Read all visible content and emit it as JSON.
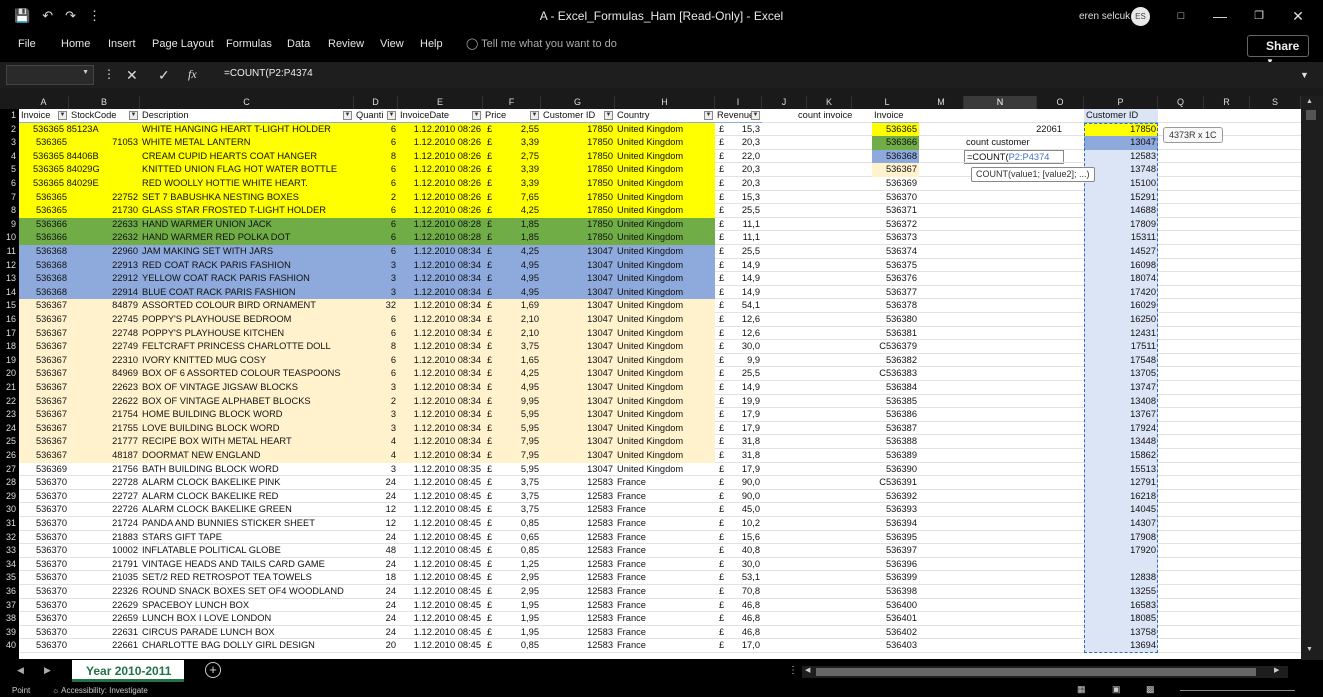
{
  "title": "A - Excel_Formulas_Ham [Read-Only] - Excel",
  "user": "eren selcuk",
  "user_initials": "ES",
  "menu": [
    "File",
    "Home",
    "Insert",
    "Page Layout",
    "Formulas",
    "Data",
    "Review",
    "View",
    "Help"
  ],
  "tell_me": "Tell me what you want to do",
  "share": "Share",
  "formula": "=COUNT(P2:P4374",
  "fx": "fx",
  "columns": [
    "A",
    "B",
    "C",
    "D",
    "E",
    "F",
    "G",
    "H",
    "I",
    "J",
    "K",
    "L",
    "M",
    "N",
    "O",
    "P",
    "Q",
    "R",
    "S"
  ],
  "headers": [
    "Invoice",
    "StockCode",
    "Description",
    "Quanti",
    "InvoiceDate",
    "Price",
    "Customer ID",
    "Country",
    "Revenue"
  ],
  "rows": [
    [
      "536365",
      "85123A",
      "WHITE HANGING HEART T-LIGHT HOLDER",
      "6",
      "1.12.2010 08:26",
      "£",
      "2,55",
      "17850",
      "United Kingdom",
      "£",
      "15,3"
    ],
    [
      "536365",
      "71053",
      "WHITE METAL LANTERN",
      "6",
      "1.12.2010 08:26",
      "£",
      "3,39",
      "17850",
      "United Kingdom",
      "£",
      "20,3"
    ],
    [
      "536365",
      "84406B",
      "CREAM CUPID HEARTS COAT HANGER",
      "8",
      "1.12.2010 08:26",
      "£",
      "2,75",
      "17850",
      "United Kingdom",
      "£",
      "22,0"
    ],
    [
      "536365",
      "84029G",
      "KNITTED UNION FLAG HOT WATER BOTTLE",
      "6",
      "1.12.2010 08:26",
      "£",
      "3,39",
      "17850",
      "United Kingdom",
      "£",
      "20,3"
    ],
    [
      "536365",
      "84029E",
      "RED WOOLLY HOTTIE WHITE HEART.",
      "6",
      "1.12.2010 08:26",
      "£",
      "3,39",
      "17850",
      "United Kingdom",
      "£",
      "20,3"
    ],
    [
      "536365",
      "22752",
      "SET 7 BABUSHKA NESTING BOXES",
      "2",
      "1.12.2010 08:26",
      "£",
      "7,65",
      "17850",
      "United Kingdom",
      "£",
      "15,3"
    ],
    [
      "536365",
      "21730",
      "GLASS STAR FROSTED T-LIGHT HOLDER",
      "6",
      "1.12.2010 08:26",
      "£",
      "4,25",
      "17850",
      "United Kingdom",
      "£",
      "25,5"
    ],
    [
      "536366",
      "22633",
      "HAND WARMER UNION JACK",
      "6",
      "1.12.2010 08:28",
      "£",
      "1,85",
      "17850",
      "United Kingdom",
      "£",
      "11,1"
    ],
    [
      "536366",
      "22632",
      "HAND WARMER RED POLKA DOT",
      "6",
      "1.12.2010 08:28",
      "£",
      "1,85",
      "17850",
      "United Kingdom",
      "£",
      "11,1"
    ],
    [
      "536368",
      "22960",
      "JAM MAKING SET WITH JARS",
      "6",
      "1.12.2010 08:34",
      "£",
      "4,25",
      "13047",
      "United Kingdom",
      "£",
      "25,5"
    ],
    [
      "536368",
      "22913",
      "RED COAT RACK PARIS FASHION",
      "3",
      "1.12.2010 08:34",
      "£",
      "4,95",
      "13047",
      "United Kingdom",
      "£",
      "14,9"
    ],
    [
      "536368",
      "22912",
      "YELLOW COAT RACK PARIS FASHION",
      "3",
      "1.12.2010 08:34",
      "£",
      "4,95",
      "13047",
      "United Kingdom",
      "£",
      "14,9"
    ],
    [
      "536368",
      "22914",
      "BLUE COAT RACK PARIS FASHION",
      "3",
      "1.12.2010 08:34",
      "£",
      "4,95",
      "13047",
      "United Kingdom",
      "£",
      "14,9"
    ],
    [
      "536367",
      "84879",
      "ASSORTED COLOUR BIRD ORNAMENT",
      "32",
      "1.12.2010 08:34",
      "£",
      "1,69",
      "13047",
      "United Kingdom",
      "£",
      "54,1"
    ],
    [
      "536367",
      "22745",
      "POPPY'S PLAYHOUSE BEDROOM",
      "6",
      "1.12.2010 08:34",
      "£",
      "2,10",
      "13047",
      "United Kingdom",
      "£",
      "12,6"
    ],
    [
      "536367",
      "22748",
      "POPPY'S PLAYHOUSE KITCHEN",
      "6",
      "1.12.2010 08:34",
      "£",
      "2,10",
      "13047",
      "United Kingdom",
      "£",
      "12,6"
    ],
    [
      "536367",
      "22749",
      "FELTCRAFT PRINCESS CHARLOTTE DOLL",
      "8",
      "1.12.2010 08:34",
      "£",
      "3,75",
      "13047",
      "United Kingdom",
      "£",
      "30,0"
    ],
    [
      "536367",
      "22310",
      "IVORY KNITTED MUG COSY",
      "6",
      "1.12.2010 08:34",
      "£",
      "1,65",
      "13047",
      "United Kingdom",
      "£",
      "9,9"
    ],
    [
      "536367",
      "84969",
      "BOX OF 6 ASSORTED COLOUR TEASPOONS",
      "6",
      "1.12.2010 08:34",
      "£",
      "4,25",
      "13047",
      "United Kingdom",
      "£",
      "25,5"
    ],
    [
      "536367",
      "22623",
      "BOX OF VINTAGE JIGSAW BLOCKS",
      "3",
      "1.12.2010 08:34",
      "£",
      "4,95",
      "13047",
      "United Kingdom",
      "£",
      "14,9"
    ],
    [
      "536367",
      "22622",
      "BOX OF VINTAGE ALPHABET BLOCKS",
      "2",
      "1.12.2010 08:34",
      "£",
      "9,95",
      "13047",
      "United Kingdom",
      "£",
      "19,9"
    ],
    [
      "536367",
      "21754",
      "HOME BUILDING BLOCK WORD",
      "3",
      "1.12.2010 08:34",
      "£",
      "5,95",
      "13047",
      "United Kingdom",
      "£",
      "17,9"
    ],
    [
      "536367",
      "21755",
      "LOVE BUILDING BLOCK WORD",
      "3",
      "1.12.2010 08:34",
      "£",
      "5,95",
      "13047",
      "United Kingdom",
      "£",
      "17,9"
    ],
    [
      "536367",
      "21777",
      "RECIPE BOX WITH METAL HEART",
      "4",
      "1.12.2010 08:34",
      "£",
      "7,95",
      "13047",
      "United Kingdom",
      "£",
      "31,8"
    ],
    [
      "536367",
      "48187",
      "DOORMAT NEW ENGLAND",
      "4",
      "1.12.2010 08:34",
      "£",
      "7,95",
      "13047",
      "United Kingdom",
      "£",
      "31,8"
    ],
    [
      "536369",
      "21756",
      "BATH BUILDING BLOCK WORD",
      "3",
      "1.12.2010 08:35",
      "£",
      "5,95",
      "13047",
      "United Kingdom",
      "£",
      "17,9"
    ],
    [
      "536370",
      "22728",
      "ALARM CLOCK BAKELIKE PINK",
      "24",
      "1.12.2010 08:45",
      "£",
      "3,75",
      "12583",
      "France",
      "£",
      "90,0"
    ],
    [
      "536370",
      "22727",
      "ALARM CLOCK BAKELIKE RED",
      "24",
      "1.12.2010 08:45",
      "£",
      "3,75",
      "12583",
      "France",
      "£",
      "90,0"
    ],
    [
      "536370",
      "22726",
      "ALARM CLOCK BAKELIKE GREEN",
      "12",
      "1.12.2010 08:45",
      "£",
      "3,75",
      "12583",
      "France",
      "£",
      "45,0"
    ],
    [
      "536370",
      "21724",
      "PANDA AND BUNNIES STICKER SHEET",
      "12",
      "1.12.2010 08:45",
      "£",
      "0,85",
      "12583",
      "France",
      "£",
      "10,2"
    ],
    [
      "536370",
      "21883",
      "STARS GIFT TAPE",
      "24",
      "1.12.2010 08:45",
      "£",
      "0,65",
      "12583",
      "France",
      "£",
      "15,6"
    ],
    [
      "536370",
      "10002",
      "INFLATABLE POLITICAL GLOBE",
      "48",
      "1.12.2010 08:45",
      "£",
      "0,85",
      "12583",
      "France",
      "£",
      "40,8"
    ],
    [
      "536370",
      "21791",
      "VINTAGE HEADS AND TAILS CARD GAME",
      "24",
      "1.12.2010 08:45",
      "£",
      "1,25",
      "12583",
      "France",
      "£",
      "30,0"
    ],
    [
      "536370",
      "21035",
      "SET/2 RED RETROSPOT TEA TOWELS",
      "18",
      "1.12.2010 08:45",
      "£",
      "2,95",
      "12583",
      "France",
      "£",
      "53,1"
    ],
    [
      "536370",
      "22326",
      "ROUND SNACK BOXES SET OF4 WOODLAND",
      "24",
      "1.12.2010 08:45",
      "£",
      "2,95",
      "12583",
      "France",
      "£",
      "70,8"
    ],
    [
      "536370",
      "22629",
      "SPACEBOY LUNCH BOX",
      "24",
      "1.12.2010 08:45",
      "£",
      "1,95",
      "12583",
      "France",
      "£",
      "46,8"
    ],
    [
      "536370",
      "22659",
      "LUNCH BOX I LOVE LONDON",
      "24",
      "1.12.2010 08:45",
      "£",
      "1,95",
      "12583",
      "France",
      "£",
      "46,8"
    ],
    [
      "536370",
      "22631",
      "CIRCUS PARADE LUNCH BOX",
      "24",
      "1.12.2010 08:45",
      "£",
      "1,95",
      "12583",
      "France",
      "£",
      "46,8"
    ],
    [
      "536370",
      "22661",
      "CHARLOTTE BAG DOLLY GIRL DESIGN",
      "20",
      "1.12.2010 08:45",
      "£",
      "0,85",
      "12583",
      "France",
      "£",
      "17,0"
    ]
  ],
  "row_fills": [
    "#ffff00",
    "#ffff00",
    "#ffff00",
    "#ffff00",
    "#ffff00",
    "#ffff00",
    "#ffff00",
    "#70ad47",
    "#70ad47",
    "#8ea9db",
    "#8ea9db",
    "#8ea9db",
    "#8ea9db",
    "#fff2cc",
    "#fff2cc",
    "#fff2cc",
    "#fff2cc",
    "#fff2cc",
    "#fff2cc",
    "#fff2cc",
    "#fff2cc",
    "#fff2cc",
    "#fff2cc",
    "#fff2cc",
    "#fff2cc",
    "",
    "",
    "",
    "",
    "",
    "",
    "",
    "",
    "",
    "",
    "",
    "",
    "",
    ""
  ],
  "col_L_header": "Invoice",
  "col_L": [
    "536365",
    "536366",
    "536368",
    "536367",
    "536369",
    "536370",
    "536371",
    "536372",
    "536373",
    "536374",
    "536375",
    "536376",
    "536377",
    "536378",
    "536380",
    "536381",
    "C536379",
    "536382",
    "C536383",
    "536384",
    "536385",
    "536386",
    "536387",
    "536388",
    "536389",
    "536390",
    "C536391",
    "536392",
    "536393",
    "536394",
    "536395",
    "536397",
    "536396",
    "536399",
    "536398",
    "536400",
    "536401",
    "536402",
    "536403"
  ],
  "col_L_fills": [
    "#ffff00",
    "#70ad47",
    "#8ea9db",
    "#fff2cc"
  ],
  "count_invoice_label": "count invoice",
  "count_invoice_value": "22061",
  "count_customer_label": "count customer",
  "edit_formula_prefix": "=COUNT(",
  "edit_formula_ref": "P2:P4374",
  "col_P_header": "Customer ID",
  "col_P": [
    "17850",
    "13047",
    "12583",
    "13748",
    "15100",
    "15291",
    "14688",
    "17809",
    "15311",
    "14527",
    "16098",
    "18074",
    "17420",
    "16029",
    "16250",
    "12431",
    "17511",
    "17548",
    "13705",
    "13747",
    "13408",
    "13767",
    "17924",
    "13448",
    "15862",
    "15513",
    "12791",
    "16218",
    "14045",
    "14307",
    "17908",
    "17920",
    "",
    "12838",
    "13255",
    "16583",
    "18085",
    "13758",
    "13694"
  ],
  "col_P_fills": [
    "#ffff00",
    "#8ea9db"
  ],
  "tooltip": "COUNT(value1; [value2]; ...)",
  "size_tip": "4373R x 1C",
  "sheet_tab": "Year 2010-2011",
  "status_mode": "Point",
  "status_accessibility": "Accessibility: Investigate"
}
